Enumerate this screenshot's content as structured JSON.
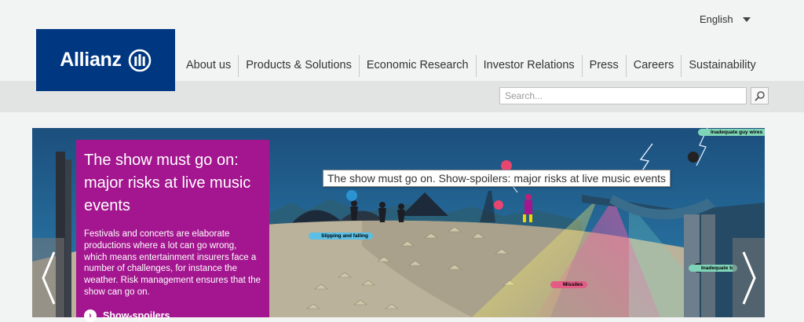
{
  "header": {
    "language": "English",
    "logo_text": "Allianz",
    "nav": [
      "About us",
      "Products & Solutions",
      "Economic Research",
      "Investor Relations",
      "Press",
      "Careers",
      "Sustainability"
    ]
  },
  "search": {
    "placeholder": "Search..."
  },
  "hero": {
    "tooltip": "The show must go on. Show-spoilers: major risks at live music events",
    "promo_title": "The show must go on: major risks at live music events",
    "promo_text": "Festivals and concerts are elaborate productions where a lot can go wrong, which means entertainment insurers face a number of challenges, for instance the weather. Risk management ensures that the show can go on.",
    "cta": "Show-spoilers",
    "labels": [
      "Inadequate guy wires",
      "Slipping and falling",
      "Missiles",
      "Inadequate b"
    ]
  },
  "colors": {
    "brand": "#003781",
    "promo": "#a3168f"
  }
}
